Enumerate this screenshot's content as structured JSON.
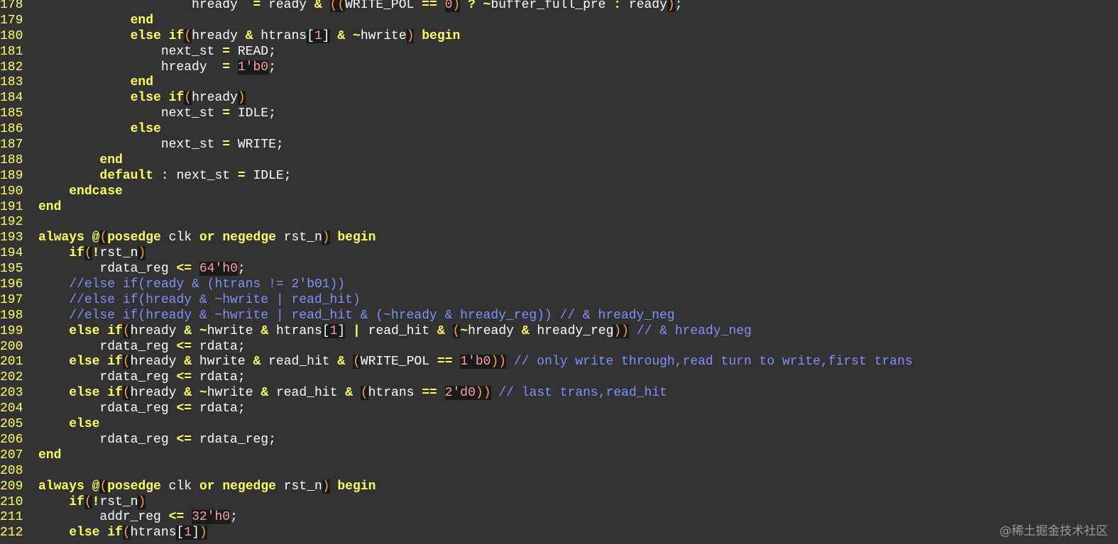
{
  "editor": {
    "lines": [
      {
        "n": "178",
        "html": "                    hready  <span class=\"op\">=</span> ready <span class=\"op\">&amp;</span> <span class=\"pn\">((</span>WRITE_POL <span class=\"op\">==</span> <span class=\"num\">0</span><span class=\"pn\">)</span> <span class=\"op\">?</span> <span class=\"op\">~</span>buffer_full_pre <span class=\"op\">:</span> ready<span class=\"pn\">)</span>;"
      },
      {
        "n": "179",
        "html": "            <span class=\"kw\">end</span>"
      },
      {
        "n": "180",
        "html": "            <span class=\"kw\">else if</span><span class=\"pn\">(</span>hready <span class=\"op\">&amp;</span> htrans<span class=\"pw\">[</span><span class=\"num\">1</span><span class=\"pw\">]</span> <span class=\"op\">&amp;</span> <span class=\"op\">~</span>hwrite<span class=\"pn\">)</span> <span class=\"kw\">begin</span>"
      },
      {
        "n": "181",
        "html": "                next_st <span class=\"op\">=</span> READ;"
      },
      {
        "n": "182",
        "html": "                hready  <span class=\"op\">=</span> <span class=\"num\">1'b0</span>;"
      },
      {
        "n": "183",
        "html": "            <span class=\"kw\">end</span>"
      },
      {
        "n": "184",
        "html": "            <span class=\"kw\">else if</span><span class=\"pn\">(</span>hready<span class=\"pn\">)</span>"
      },
      {
        "n": "185",
        "html": "                next_st <span class=\"op\">=</span> IDLE;"
      },
      {
        "n": "186",
        "html": "            <span class=\"kw\">else</span>"
      },
      {
        "n": "187",
        "html": "                next_st <span class=\"op\">=</span> WRITE;"
      },
      {
        "n": "188",
        "html": "        <span class=\"kw\">end</span>"
      },
      {
        "n": "189",
        "html": "        <span class=\"kw\">default</span> : next_st <span class=\"op\">=</span> IDLE;"
      },
      {
        "n": "190",
        "html": "    <span class=\"kw\">endcase</span>"
      },
      {
        "n": "191",
        "html": "<span class=\"kw\">end</span>"
      },
      {
        "n": "192",
        "html": ""
      },
      {
        "n": "193",
        "html": "<span class=\"kw\">always</span> <span class=\"op\">@</span><span class=\"pn\">(</span><span class=\"kw\">posedge</span> clk <span class=\"kw\">or</span> <span class=\"kw\">negedge</span> rst_n<span class=\"pn\">)</span> <span class=\"kw\">begin</span>"
      },
      {
        "n": "194",
        "html": "    <span class=\"kw\">if</span><span class=\"pn\">(</span><span class=\"op\">!</span>rst_n<span class=\"pn\">)</span>"
      },
      {
        "n": "195",
        "html": "        rdata_reg <span class=\"op\">&lt;=</span> <span class=\"num\">64'h0</span>;"
      },
      {
        "n": "196",
        "html": "    <span class=\"cm\">//else if(ready &amp; (htrans != 2'b01))</span>"
      },
      {
        "n": "197",
        "html": "    <span class=\"cm\">//else if(hready &amp; ~hwrite | read_hit)</span>"
      },
      {
        "n": "198",
        "html": "    <span class=\"cm\">//else if(hready &amp; ~hwrite | read_hit &amp; (~hready &amp; hready_reg)) // &amp; hready_neg</span>"
      },
      {
        "n": "199",
        "html": "    <span class=\"kw\">else if</span><span class=\"pn\">(</span>hready <span class=\"op\">&amp;</span> <span class=\"op\">~</span>hwrite <span class=\"op\">&amp;</span> htrans<span class=\"pw\">[</span><span class=\"num\">1</span><span class=\"pw\">]</span> <span class=\"op\">|</span> read_hit <span class=\"op\">&amp;</span> <span class=\"pn\">(</span><span class=\"op\">~</span>hready <span class=\"op\">&amp;</span> hready_reg<span class=\"pn\">))</span> <span class=\"cm\">// &amp; hready_neg</span>"
      },
      {
        "n": "200",
        "html": "        rdata_reg <span class=\"op\">&lt;=</span> rdata;"
      },
      {
        "n": "201",
        "html": "    <span class=\"kw\">else if</span><span class=\"pn\">(</span>hready <span class=\"op\">&amp;</span> hwrite <span class=\"op\">&amp;</span> read_hit <span class=\"op\">&amp;</span> <span class=\"pn\">(</span>WRITE_POL <span class=\"op\">==</span> <span class=\"num\">1'b0</span><span class=\"pn\">))</span> <span class=\"cm\">// only write through,read turn to write,first trans</span>"
      },
      {
        "n": "202",
        "html": "        rdata_reg <span class=\"op\">&lt;=</span> rdata;"
      },
      {
        "n": "203",
        "html": "    <span class=\"kw\">else if</span><span class=\"pn\">(</span>hready <span class=\"op\">&amp;</span> <span class=\"op\">~</span>hwrite <span class=\"op\">&amp;</span> read_hit <span class=\"op\">&amp;</span> <span class=\"pn\">(</span>htrans <span class=\"op\">==</span> <span class=\"num\">2'd0</span><span class=\"pn\">))</span> <span class=\"cm\">// last trans,read_hit</span>"
      },
      {
        "n": "204",
        "html": "        rdata_reg <span class=\"op\">&lt;=</span> rdata;"
      },
      {
        "n": "205",
        "html": "    <span class=\"kw\">else</span>"
      },
      {
        "n": "206",
        "html": "        rdata_reg <span class=\"op\">&lt;=</span> rdata_reg;"
      },
      {
        "n": "207",
        "html": "<span class=\"kw\">end</span>"
      },
      {
        "n": "208",
        "html": ""
      },
      {
        "n": "209",
        "html": "<span class=\"kw\">always</span> <span class=\"op\">@</span><span class=\"pn\">(</span><span class=\"kw\">posedge</span> clk <span class=\"kw\">or</span> <span class=\"kw\">negedge</span> rst_n<span class=\"pn\">)</span> <span class=\"kw\">begin</span>"
      },
      {
        "n": "210",
        "html": "    <span class=\"kw\">if</span><span class=\"pn\">(</span><span class=\"op\">!</span>rst_n<span class=\"pn\">)</span>"
      },
      {
        "n": "211",
        "html": "        addr_reg <span class=\"op\">&lt;=</span> <span class=\"num\">32'h0</span>;"
      },
      {
        "n": "212",
        "html": "    <span class=\"kw\">else if</span><span class=\"pn\">(</span>htrans<span class=\"pw\">[</span><span class=\"num\">1</span><span class=\"pw\">]</span><span class=\"pn\">)</span>"
      }
    ]
  },
  "watermark": {
    "text": "@稀土掘金技术社区"
  },
  "colors": {
    "background": "#333333",
    "line_number": "#ffff60",
    "keyword": "#ffff60",
    "comment": "#8090ff",
    "number": "#ffa0a0",
    "paren": "#ffa040",
    "text": "#ffffff"
  }
}
